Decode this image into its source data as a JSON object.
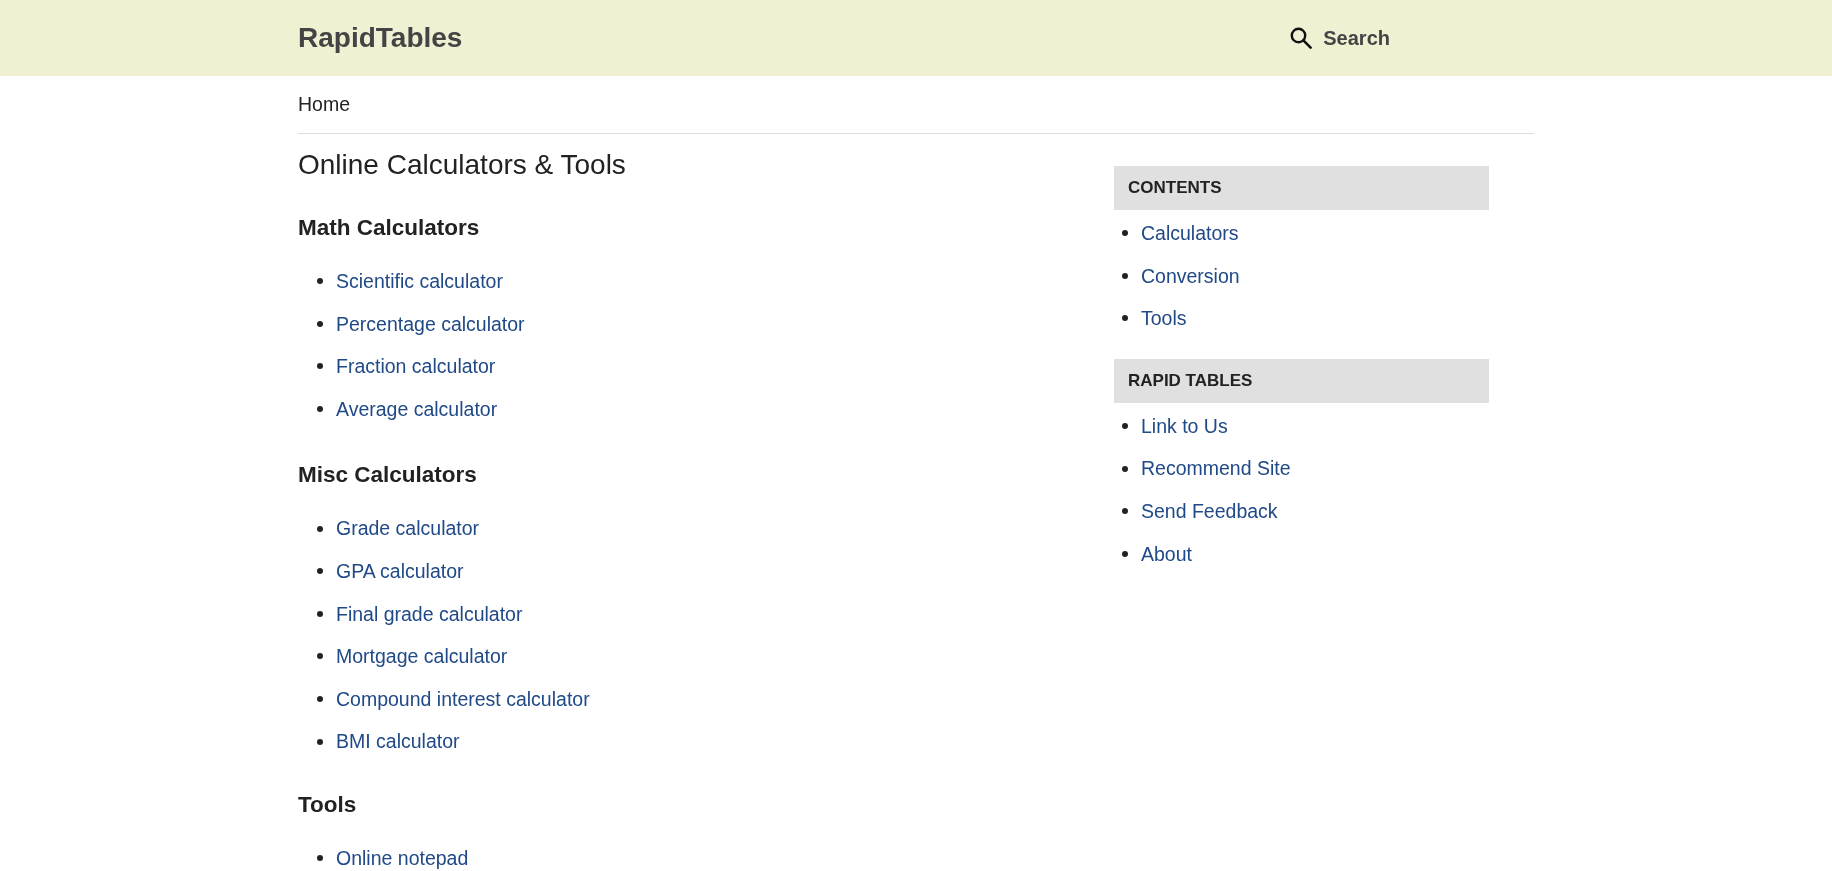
{
  "header": {
    "logo": "RapidTables",
    "search": {
      "label": "Search"
    }
  },
  "breadcrumb": [
    "Home"
  ],
  "main": {
    "title": "Online Calculators & Tools",
    "sections": [
      {
        "heading": "Math Calculators",
        "links": [
          "Scientific calculator",
          "Percentage calculator",
          "Fraction calculator",
          "Average calculator"
        ]
      },
      {
        "heading": "Misc Calculators",
        "links": [
          "Grade calculator",
          "GPA calculator",
          "Final grade calculator",
          "Mortgage calculator",
          "Compound interest calculator",
          "BMI calculator"
        ]
      },
      {
        "heading": "Tools",
        "links": [
          "Online notepad"
        ]
      }
    ]
  },
  "sidebar": {
    "sections": [
      {
        "heading": "CONTENTS",
        "links": [
          "Calculators",
          "Conversion",
          "Tools"
        ]
      },
      {
        "heading": "RAPID TABLES",
        "links": [
          "Link to Us",
          "Recommend Site",
          "Send Feedback",
          "About"
        ]
      }
    ]
  }
}
